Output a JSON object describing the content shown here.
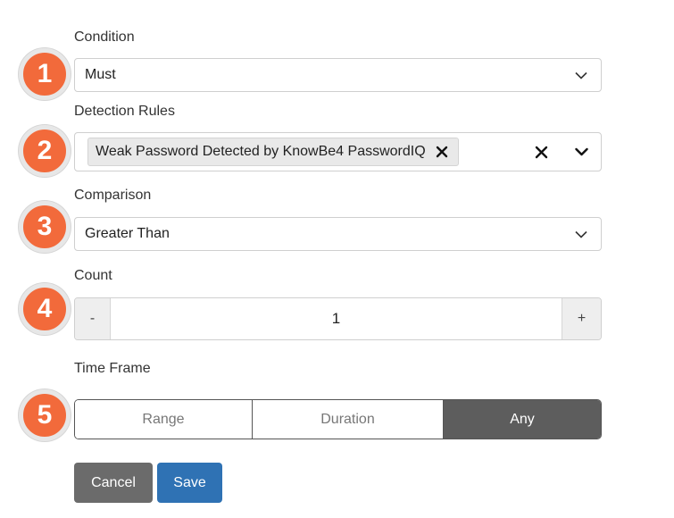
{
  "steps": [
    "1",
    "2",
    "3",
    "4",
    "5"
  ],
  "condition": {
    "label": "Condition",
    "value": "Must"
  },
  "detection_rules": {
    "label": "Detection Rules",
    "tags": [
      "Weak Password Detected by KnowBe4 PasswordIQ"
    ]
  },
  "comparison": {
    "label": "Comparison",
    "value": "Greater Than"
  },
  "count": {
    "label": "Count",
    "minus": "-",
    "value": "1",
    "plus": "+"
  },
  "time_frame": {
    "label": "Time Frame",
    "options": [
      "Range",
      "Duration",
      "Any"
    ],
    "selected": "Any"
  },
  "actions": {
    "cancel": "Cancel",
    "save": "Save"
  },
  "colors": {
    "badge": "#f26a3b",
    "save": "#2f72b4",
    "cancel": "#6b6b6b",
    "segment_active": "#5d5d5d"
  },
  "icons": {
    "dropdown": "chevron-down-icon",
    "remove": "close-icon"
  }
}
